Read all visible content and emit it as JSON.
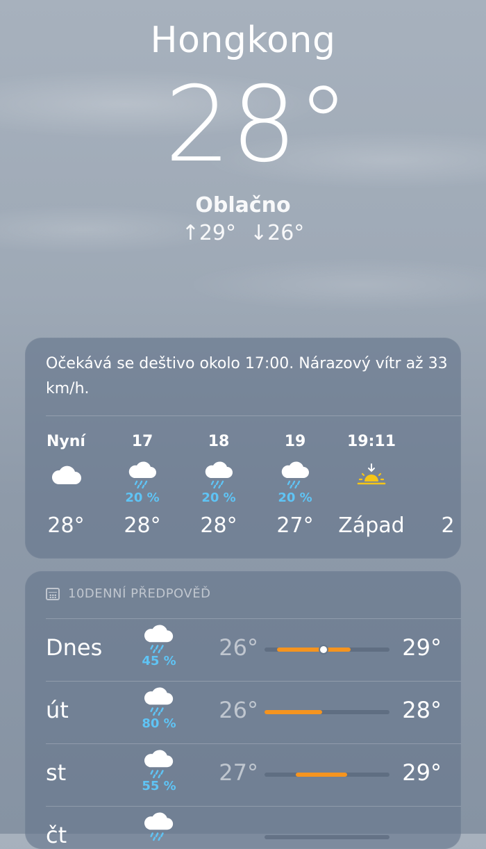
{
  "location": {
    "city": "Hongkong",
    "temperature": "28°",
    "condition": "Oblačno",
    "high": "↑29°",
    "low": "↓26°"
  },
  "hourly_card": {
    "summary": "Očekává se deštivo okolo 17:00. Nárazový vítr až 33 km/h.",
    "hours": [
      {
        "label": "Nyní",
        "icon": "cloud-icon",
        "precip": "",
        "temp": "28°"
      },
      {
        "label": "17",
        "icon": "cloud-rain-icon",
        "precip": "20 %",
        "temp": "28°"
      },
      {
        "label": "18",
        "icon": "cloud-rain-icon",
        "precip": "20 %",
        "temp": "28°"
      },
      {
        "label": "19",
        "icon": "cloud-rain-icon",
        "precip": "20 %",
        "temp": "27°"
      },
      {
        "label": "19:11",
        "icon": "sunset-icon",
        "precip": "",
        "temp": "Západ"
      },
      {
        "label": "",
        "icon": "",
        "precip": "",
        "temp": "2"
      }
    ]
  },
  "forecast": {
    "header": "10DENNÍ PŘEDPOVĚĎ",
    "days": [
      {
        "day": "Dnes",
        "icon": "cloud-rain-icon",
        "precip": "45 %",
        "low": "26°",
        "high": "29°",
        "bar_start": 0.1,
        "bar_end": 0.69,
        "current": 0.47
      },
      {
        "day": "út",
        "icon": "cloud-rain-icon",
        "precip": "80 %",
        "low": "26°",
        "high": "28°",
        "bar_start": 0.0,
        "bar_end": 0.46
      },
      {
        "day": "st",
        "icon": "cloud-rain-icon",
        "precip": "55 %",
        "low": "27°",
        "high": "29°",
        "bar_start": 0.25,
        "bar_end": 0.66
      },
      {
        "day": "čt",
        "icon": "cloud-rain-icon",
        "precip": "",
        "low": "",
        "high": "",
        "bar_start": 0.0,
        "bar_end": 0.0
      }
    ]
  },
  "colors": {
    "accent_orange": "#f5941f",
    "precip_blue": "#5fc4f5",
    "sun_yellow": "#f5c518"
  }
}
